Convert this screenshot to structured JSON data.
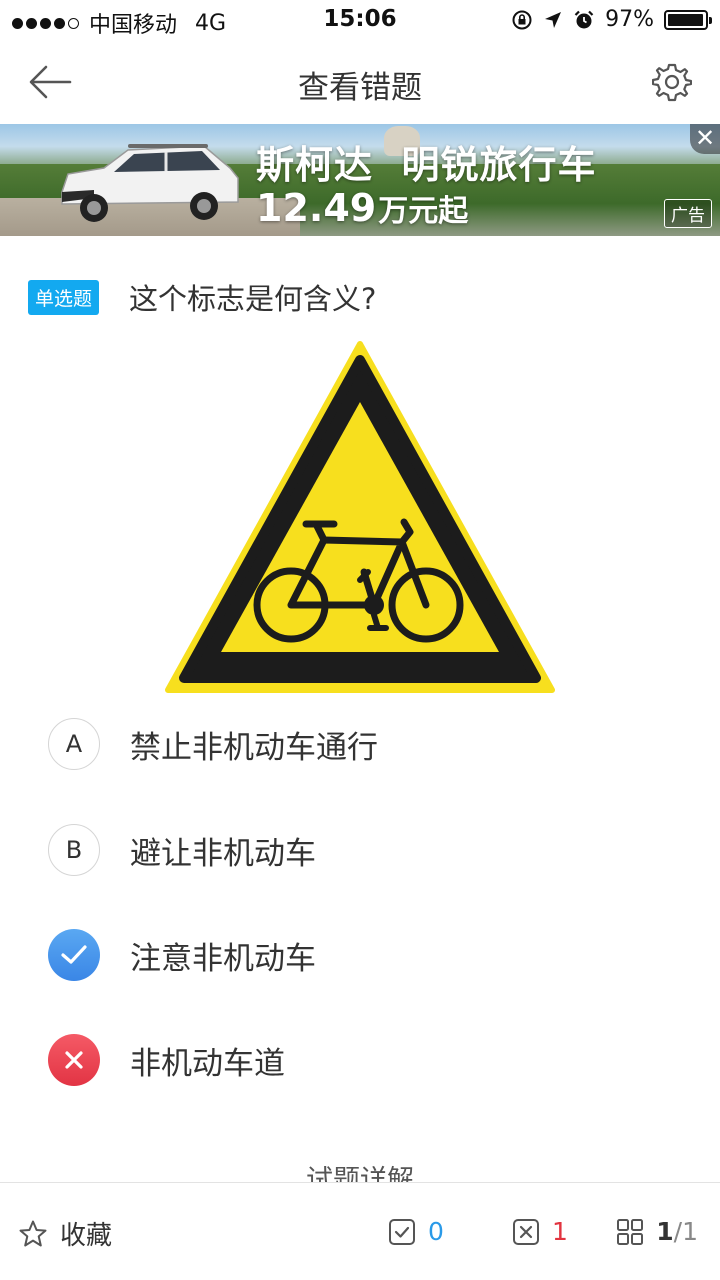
{
  "status_bar": {
    "carrier": "中国移动",
    "network": "4G",
    "time": "15:06",
    "battery": "97%",
    "battery_level": 0.97
  },
  "nav": {
    "title": "查看错题",
    "back_icon": "back-arrow-icon",
    "settings_icon": "gear-icon"
  },
  "ad": {
    "line1": "斯柯达  明锐旅行车",
    "price": "12.49",
    "price_suffix": "万元起",
    "tag": "广告",
    "close": "✕"
  },
  "question": {
    "type_tag": "单选题",
    "text": "这个标志是何含义?",
    "tag_color": "#13a9f0"
  },
  "options": [
    {
      "letter": "A",
      "text": "禁止非机动车通行",
      "state": "normal"
    },
    {
      "letter": "B",
      "text": "避让非机动车",
      "state": "normal"
    },
    {
      "letter": "",
      "text": "注意非机动车",
      "state": "correct"
    },
    {
      "letter": "",
      "text": "非机动车道",
      "state": "wrong"
    }
  ],
  "explanation_header": "试题详解",
  "bottom_bar": {
    "favorite_label": "收藏",
    "correct_count": "0",
    "wrong_count": "1",
    "current": "1",
    "total": "/1",
    "correct_color": "#2a9ae8",
    "wrong_color": "#e2343f"
  }
}
